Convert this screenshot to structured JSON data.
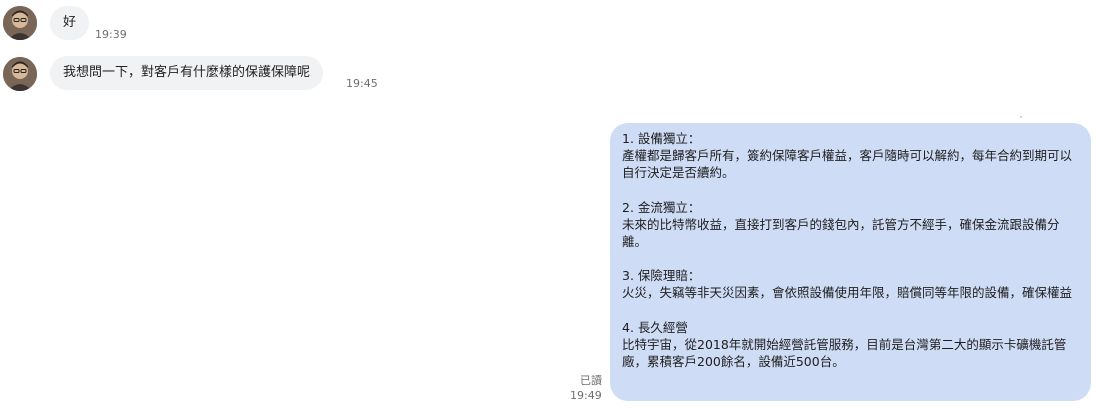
{
  "messages_in": [
    {
      "text": "好",
      "time": "19:39"
    },
    {
      "text": "我想問一下，對客戶有什麼樣的保護保障呢",
      "time": "19:45"
    }
  ],
  "message_out": {
    "sections": [
      {
        "title": "1. 設備獨立：",
        "body": "產權都是歸客戶所有，簽約保障客戶權益，客戶隨時可以解約，每年合約到期可以自行決定是否續約。"
      },
      {
        "title": "2. 金流獨立：",
        "body": "未來的比特幣收益，直接打到客戶的錢包內，託管方不經手，確保金流跟設備分離。"
      },
      {
        "title": "3. 保險理賠：",
        "body": "火災，失竊等非天災因素，會依照設備使用年限，賠償同等年限的設備，確保權益"
      },
      {
        "title": "4. 長久經營",
        "body": "比特宇宙，從2018年就開始經營託管服務，目前是台灣第二大的顯示卡礦機託管廠，累積客戶200餘名，設備近500台。"
      }
    ],
    "read_label": "已讀",
    "time": "19:49"
  },
  "colors": {
    "incoming_bubble": "#f1f2f4",
    "outgoing_bubble": "#cfdcf5",
    "timestamp": "#6f6f6f"
  }
}
